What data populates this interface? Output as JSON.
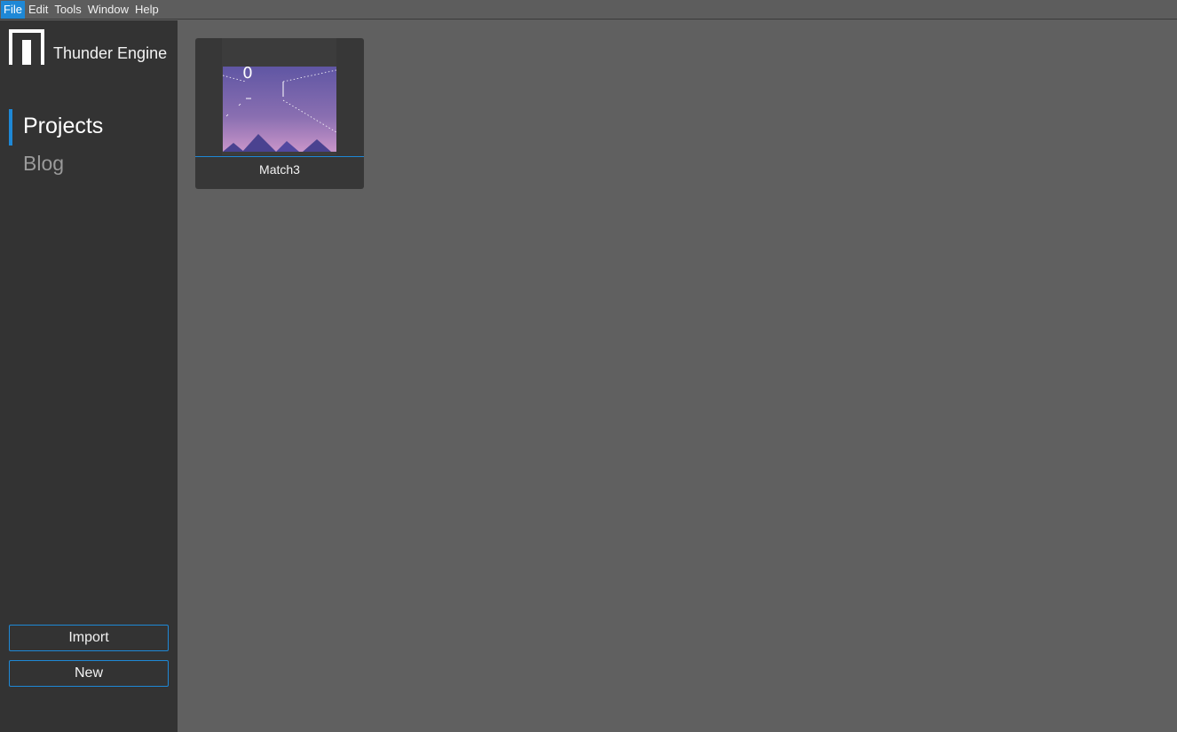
{
  "menubar": {
    "items": [
      "File",
      "Edit",
      "Tools",
      "Window",
      "Help"
    ]
  },
  "sidebar": {
    "app_title": "Thunder Engine",
    "nav": {
      "projects": "Projects",
      "blog": "Blog"
    },
    "buttons": {
      "import": "Import",
      "new": "New"
    }
  },
  "projects": [
    {
      "name": "Match3",
      "thumbnail_score": "0"
    }
  ],
  "colors": {
    "accent": "#1e88d6",
    "sidebar_bg": "#333333",
    "content_bg": "#606060",
    "card_bg": "#373737"
  }
}
